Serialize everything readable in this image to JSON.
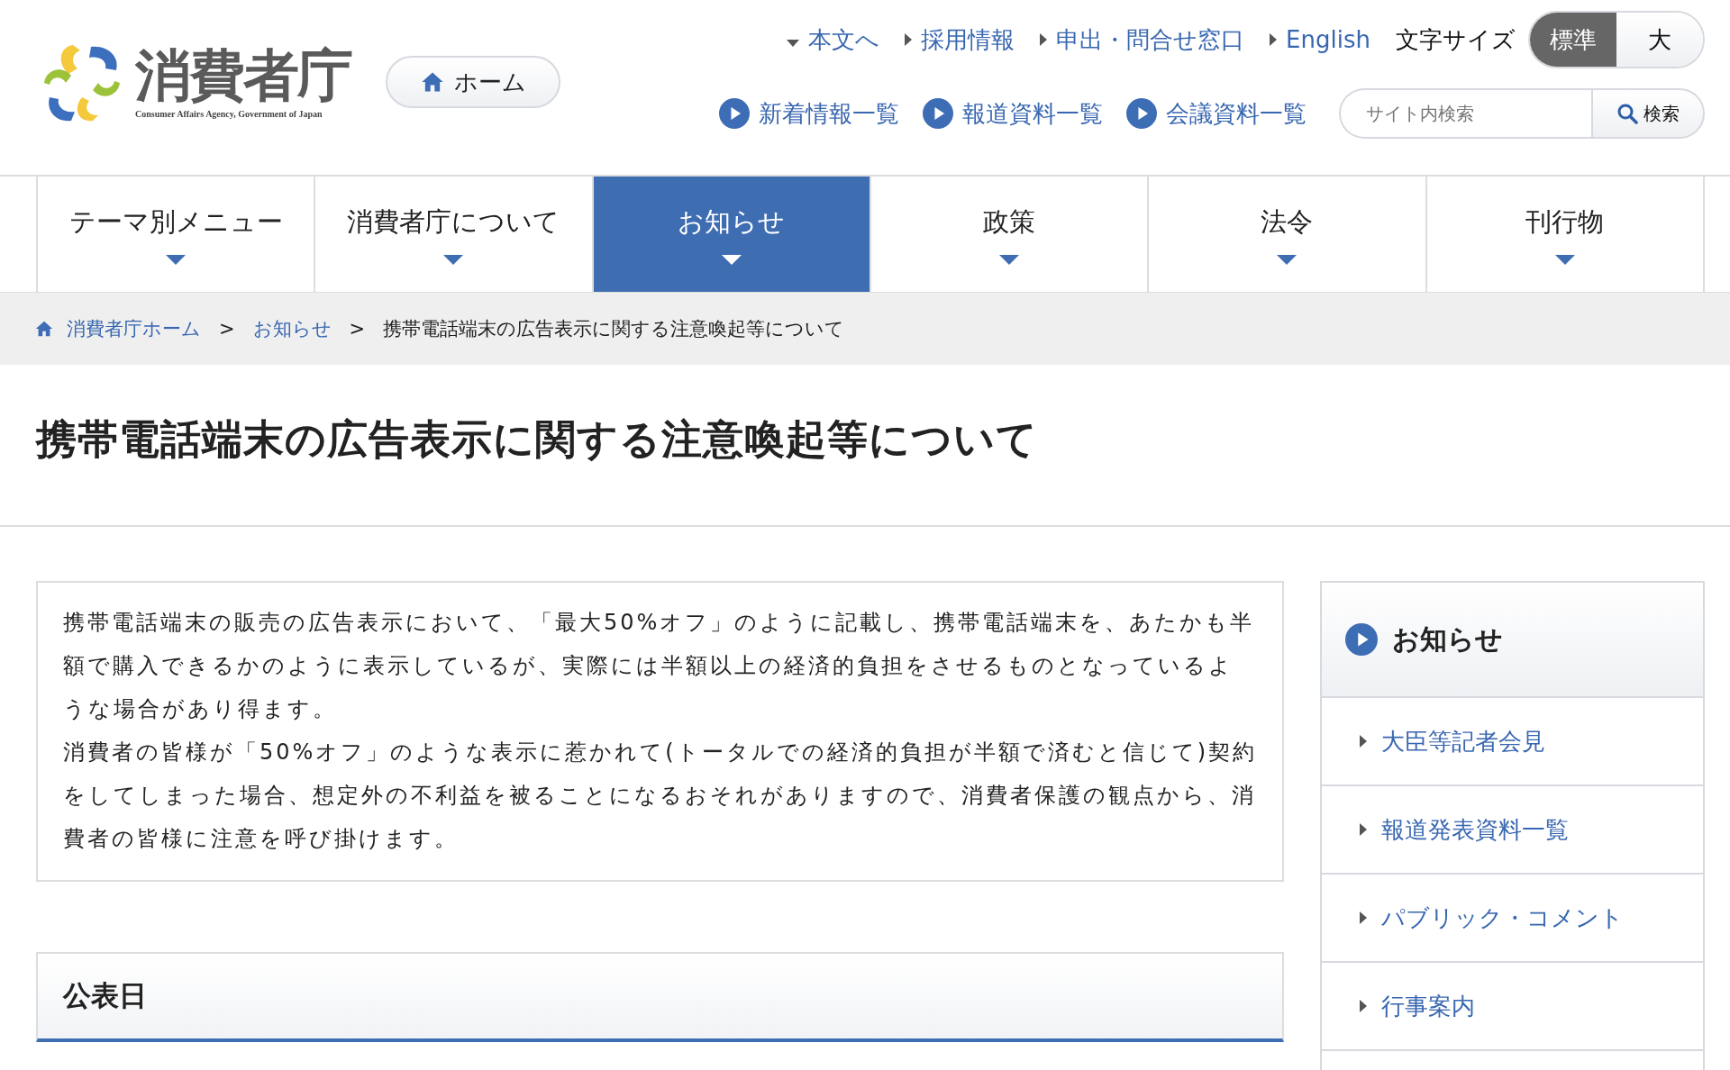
{
  "logo": {
    "name": "消費者庁",
    "subtitle": "Consumer Affairs Agency, Government of Japan"
  },
  "home_button": "ホーム",
  "utility_links": [
    {
      "label": "本文へ",
      "kind": "down"
    },
    {
      "label": "採用情報",
      "kind": "right"
    },
    {
      "label": "申出・問合せ窓口",
      "kind": "right"
    },
    {
      "label": "English",
      "kind": "right"
    }
  ],
  "font_size": {
    "label": "文字サイズ",
    "options": [
      {
        "label": "標準",
        "selected": true
      },
      {
        "label": "大",
        "selected": false
      }
    ]
  },
  "quick_links": [
    "新着情報一覧",
    "報道資料一覧",
    "会議資料一覧"
  ],
  "search": {
    "placeholder": "サイト内検索",
    "button": "検索"
  },
  "main_nav": [
    {
      "label": "テーマ別メニュー",
      "selected": false
    },
    {
      "label": "消費者庁について",
      "selected": false
    },
    {
      "label": "お知らせ",
      "selected": true
    },
    {
      "label": "政策",
      "selected": false
    },
    {
      "label": "法令",
      "selected": false
    },
    {
      "label": "刊行物",
      "selected": false
    }
  ],
  "breadcrumb": {
    "links": [
      "消費者庁ホーム",
      "お知らせ"
    ],
    "separators": [
      ">",
      ">"
    ],
    "current": "携帯電話端末の広告表示に関する注意喚起等について"
  },
  "page_title": "携帯電話端末の広告表示に関する注意喚起等について",
  "notice_paragraphs": [
    "携帯電話端末の販売の広告表示において、「最大50%オフ」のように記載し、携帯電話端末を、あたかも半額で購入できるかのように表示しているが、実際には半額以上の経済的負担をさせるものとなっているような場合があり得ます。",
    "消費者の皆様が「50%オフ」のような表示に惹かれて(トータルでの経済的負担が半額で済むと信じて)契約をしてしまった場合、想定外の不利益を被ることになるおそれがありますので、消費者保護の観点から、消費者の皆様に注意を呼び掛けます。"
  ],
  "section_heading": "公表日",
  "sidebar": {
    "title": "お知らせ",
    "items": [
      "大臣等記者会見",
      "報道発表資料一覧",
      "パブリック・コメント",
      "行事案内"
    ]
  }
}
